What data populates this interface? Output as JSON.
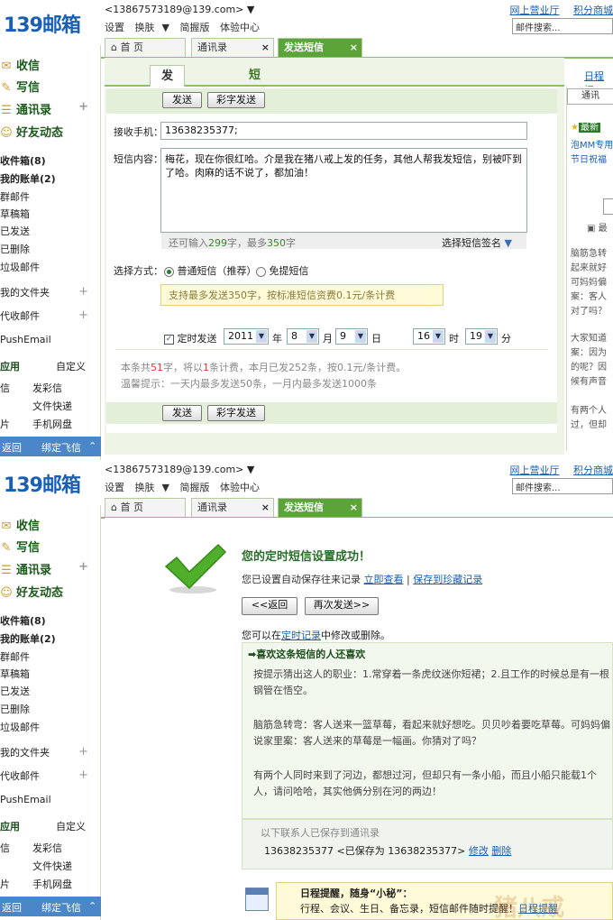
{
  "app": {
    "logo_text": "139邮箱",
    "email": "<13867573189@139.com>",
    "header_links": [
      "设置",
      "换肤",
      "简握版",
      "体验中心"
    ],
    "top_right_links": [
      "网上营业厅",
      "积分商城"
    ],
    "mail_search_placeholder": "邮件搜索..."
  },
  "tabs": [
    {
      "label": "首 页"
    },
    {
      "label": "通讯录"
    },
    {
      "label": "发送短信"
    }
  ],
  "sidebar": {
    "main_items": [
      {
        "label": "收信",
        "icon": "inbox-icon"
      },
      {
        "label": "写信",
        "icon": "compose-icon"
      },
      {
        "label": "通讯录",
        "icon": "contacts-icon"
      },
      {
        "label": "好友动态",
        "icon": "friends-icon"
      }
    ],
    "folder_items": [
      {
        "label": "收件箱(8)",
        "bold": true
      },
      {
        "label": "我的账单(2)",
        "bold": true
      },
      {
        "label": "群邮件"
      },
      {
        "label": "草稿箱"
      },
      {
        "label": "已发送"
      },
      {
        "label": "已删除"
      },
      {
        "label": "垃圾邮件"
      }
    ],
    "extra_items": [
      "我的文件夹",
      "代收邮件",
      "PushEmail"
    ],
    "apps_title": "应用",
    "apps_custom": "自定义",
    "apps_left": [
      "信",
      "",
      "片"
    ],
    "apps_right": [
      "发彩信",
      "文件快递",
      "手机网盘"
    ],
    "bottom_left": "返回",
    "bottom_right": "绑定飞信",
    "bottom_chevron": "≈"
  },
  "sms_form": {
    "subtab_active": "发短信",
    "subtab_other": "短信记录",
    "right_link": "日程提",
    "send_btn": "发送",
    "mms_btn": "彩字发送",
    "phone_label": "接收手机：",
    "phone_value": "13638235377;",
    "content_label": "短信内容：",
    "content_value": "梅花，现在你很红哈。介是我在猪八戒上发的任务，其他人帮我发短信，别被吓到了哈。肉麻的话不说了，都加油！",
    "remaining_prefix": "还可输入",
    "remaining_num": "299",
    "remaining_mid": "字，最多",
    "remaining_max": "350",
    "remaining_suffix": "字",
    "signature_label": "选择短信签名",
    "method_label": "选择方式：",
    "method_normal": "普通短信（推荐）",
    "method_free": "免提短信",
    "hint_text": "支持最多发送350字，按标准短信资费0.1元/条计费",
    "timed_label": "定时发送",
    "year": "2011",
    "year_unit": "年",
    "month": "8",
    "month_unit": "月",
    "day": "9",
    "day_unit": "日",
    "hour": "16",
    "hour_unit": "时",
    "minute": "19",
    "minute_unit": "分",
    "count_line_prefix": "本条共",
    "count_chars": "51",
    "count_mid": "字，将以",
    "count_msgs": "1",
    "count_suffix": "条计费，本月已发252条，按0.1元/条计费。",
    "tip_line": "温馨提示：一天内最多发送50条，一月内最多发送1000条"
  },
  "right_strip": {
    "search_btn": "通讯",
    "latest_badge": "最新",
    "link1": "泡MM专用",
    "link2": "节日祝福",
    "box_lines": [
      "脑筋急转",
      "起来就好",
      "可妈妈偏",
      "案：客人",
      "对了吗？"
    ],
    "box2_lines": [
      "大家知道",
      "案：因为",
      "的呢？因",
      "候有声音"
    ],
    "box3_lines": [
      "有两个人",
      "过，但却"
    ],
    "button_right": "最"
  },
  "success": {
    "title": "您的定时短信设置成功！",
    "saved_text": "您已设置自动保存往来记录",
    "view_now": "立即查看",
    "save_fav": "保存到珍藏记录",
    "back_btn": "<<返回",
    "resend_btn": "再次发送>>",
    "manage_prefix": "您可以在",
    "manage_link": "定时记录",
    "manage_suffix": "中修改或删除。",
    "like_title": "➡喜欢这条短信的人还喜欢",
    "riddles": [
      "按提示猜出这人的职业：1.常穿着一条虎纹迷你短裙；2.且工作的时候总是有一根钢管在悟空。",
      "脑筋急转弯：客人送来一篮草莓，看起来就好想吃。贝贝吵着要吃草莓。可妈妈偏说家里案：客人送来的草莓是一幅画。你猜对了吗？",
      "有两个人同时来到了河边，都想过河，但却只有一条小船，而且小船只能载1个人，请问哈哈，其实他俩分别在河的两边！"
    ],
    "contacts_saved_label": "以下联系人已保存到通讯录",
    "contact_number": "13638235377",
    "contact_saved_as": "<已保存为 13638235377>",
    "contact_edit": "修改",
    "contact_delete": "删除",
    "promo_title": "日程提醒，随身“小秘”：",
    "promo_text": "行程、会议、生日、备忘录，短信邮件随时提醒！",
    "promo_link": "日程提醒",
    "watermark": "猪八戒"
  }
}
